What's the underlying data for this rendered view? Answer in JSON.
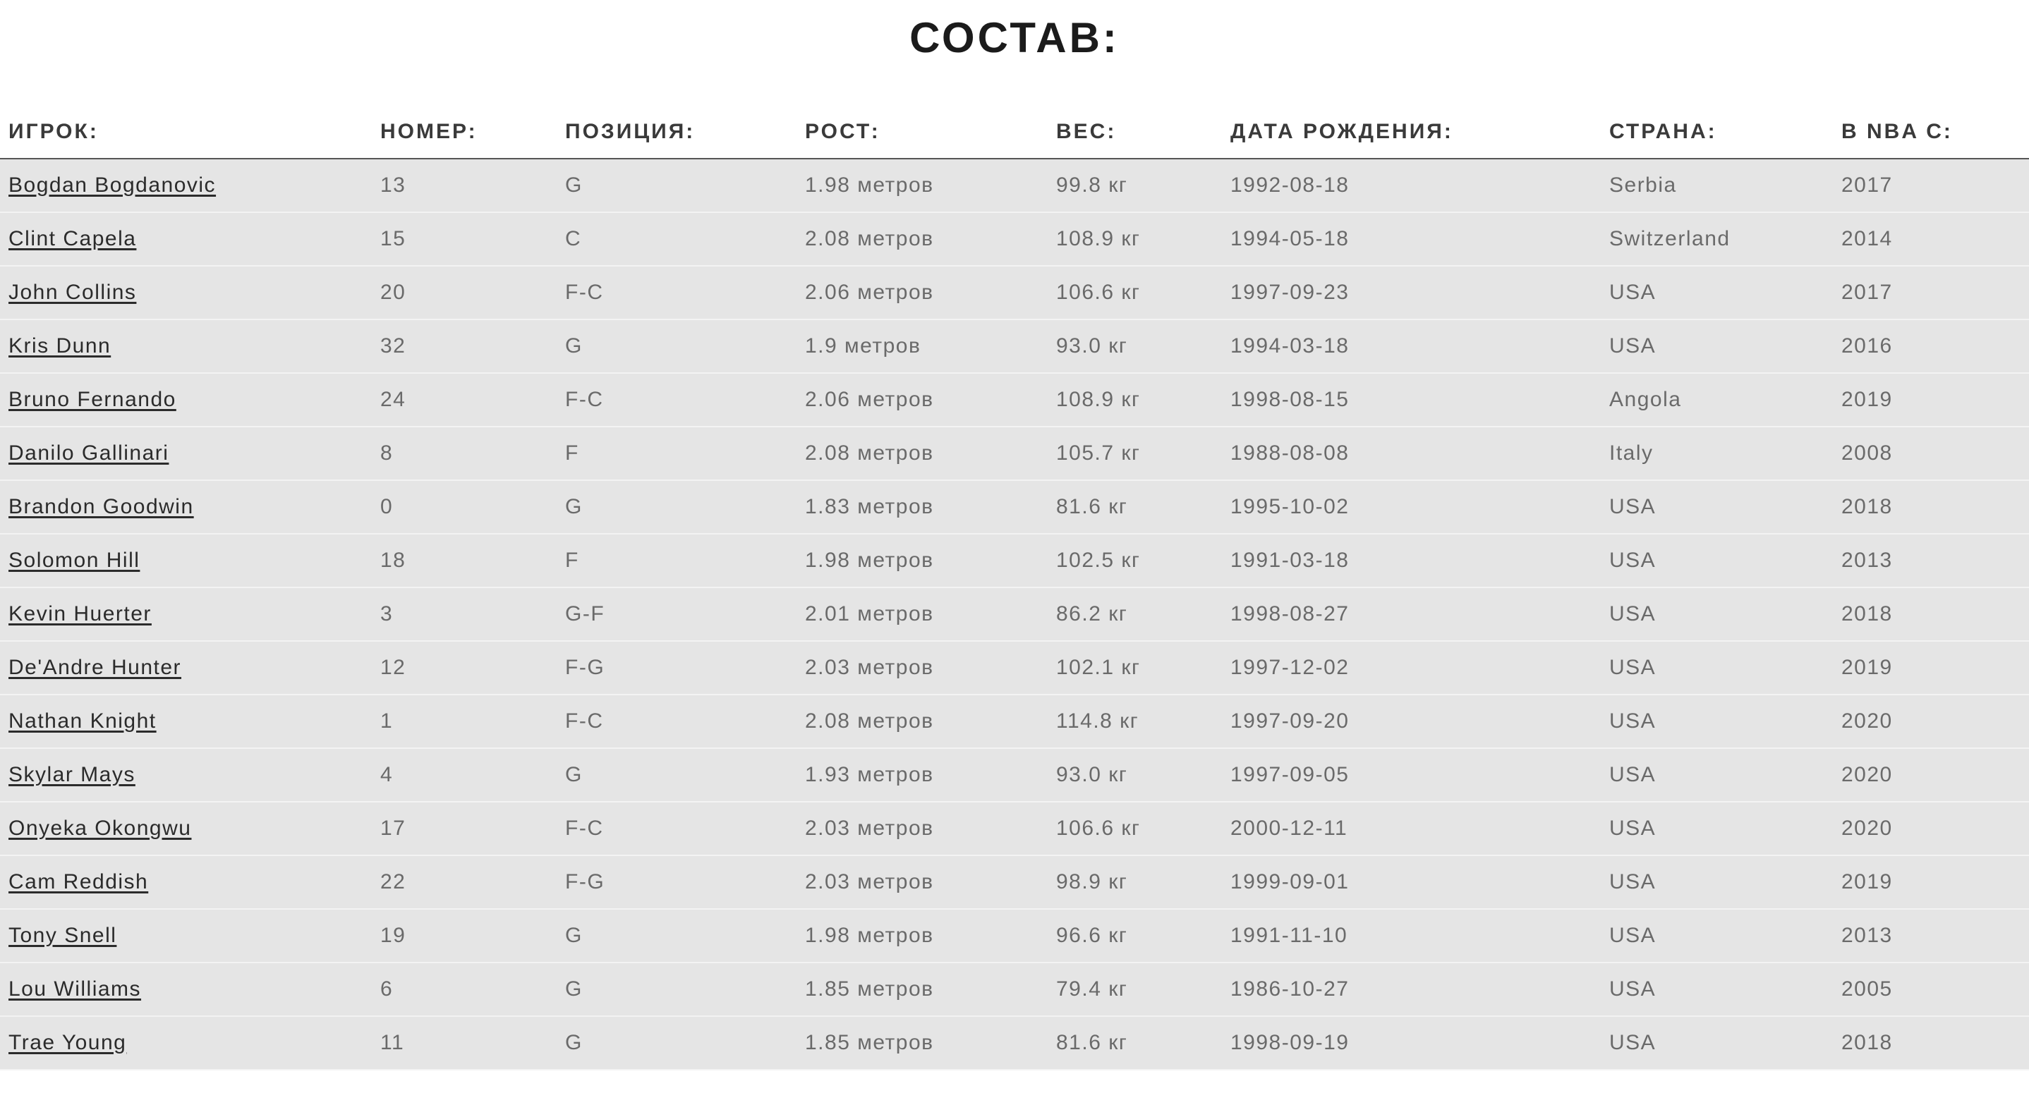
{
  "page": {
    "title": "СОСТАВ:"
  },
  "table": {
    "headers": {
      "player": "ИГРОК:",
      "number": "НОМЕР:",
      "position": "ПОЗИЦИЯ:",
      "height": "РОСТ:",
      "weight": "ВЕС:",
      "birthdate": "ДАТА РОЖДЕНИЯ:",
      "country": "СТРАНА:",
      "nba_since": "В NBA С:"
    },
    "rows": [
      {
        "player": "Bogdan Bogdanovic",
        "number": "13",
        "position": "G",
        "height": "1.98 метров",
        "weight": "99.8 кг",
        "birthdate": "1992-08-18",
        "country": "Serbia",
        "nba_since": "2017"
      },
      {
        "player": "Clint Capela",
        "number": "15",
        "position": "C",
        "height": "2.08 метров",
        "weight": "108.9 кг",
        "birthdate": "1994-05-18",
        "country": "Switzerland",
        "nba_since": "2014"
      },
      {
        "player": "John Collins",
        "number": "20",
        "position": "F-C",
        "height": "2.06 метров",
        "weight": "106.6 кг",
        "birthdate": "1997-09-23",
        "country": "USA",
        "nba_since": "2017"
      },
      {
        "player": "Kris Dunn",
        "number": "32",
        "position": "G",
        "height": "1.9 метров",
        "weight": "93.0 кг",
        "birthdate": "1994-03-18",
        "country": "USA",
        "nba_since": "2016"
      },
      {
        "player": "Bruno Fernando",
        "number": "24",
        "position": "F-C",
        "height": "2.06 метров",
        "weight": "108.9 кг",
        "birthdate": "1998-08-15",
        "country": "Angola",
        "nba_since": "2019"
      },
      {
        "player": "Danilo Gallinari",
        "number": "8",
        "position": "F",
        "height": "2.08 метров",
        "weight": "105.7 кг",
        "birthdate": "1988-08-08",
        "country": "Italy",
        "nba_since": "2008"
      },
      {
        "player": "Brandon Goodwin",
        "number": "0",
        "position": "G",
        "height": "1.83 метров",
        "weight": "81.6 кг",
        "birthdate": "1995-10-02",
        "country": "USA",
        "nba_since": "2018"
      },
      {
        "player": "Solomon Hill",
        "number": "18",
        "position": "F",
        "height": "1.98 метров",
        "weight": "102.5 кг",
        "birthdate": "1991-03-18",
        "country": "USA",
        "nba_since": "2013"
      },
      {
        "player": "Kevin Huerter",
        "number": "3",
        "position": "G-F",
        "height": "2.01 метров",
        "weight": "86.2 кг",
        "birthdate": "1998-08-27",
        "country": "USA",
        "nba_since": "2018"
      },
      {
        "player": "De'Andre Hunter",
        "number": "12",
        "position": "F-G",
        "height": "2.03 метров",
        "weight": "102.1 кг",
        "birthdate": "1997-12-02",
        "country": "USA",
        "nba_since": "2019"
      },
      {
        "player": "Nathan Knight",
        "number": "1",
        "position": "F-C",
        "height": "2.08 метров",
        "weight": "114.8 кг",
        "birthdate": "1997-09-20",
        "country": "USA",
        "nba_since": "2020"
      },
      {
        "player": "Skylar Mays",
        "number": "4",
        "position": "G",
        "height": "1.93 метров",
        "weight": "93.0 кг",
        "birthdate": "1997-09-05",
        "country": "USA",
        "nba_since": "2020"
      },
      {
        "player": "Onyeka Okongwu",
        "number": "17",
        "position": "F-C",
        "height": "2.03 метров",
        "weight": "106.6 кг",
        "birthdate": "2000-12-11",
        "country": "USA",
        "nba_since": "2020"
      },
      {
        "player": "Cam Reddish",
        "number": "22",
        "position": "F-G",
        "height": "2.03 метров",
        "weight": "98.9 кг",
        "birthdate": "1999-09-01",
        "country": "USA",
        "nba_since": "2019"
      },
      {
        "player": "Tony Snell",
        "number": "19",
        "position": "G",
        "height": "1.98 метров",
        "weight": "96.6 кг",
        "birthdate": "1991-11-10",
        "country": "USA",
        "nba_since": "2013"
      },
      {
        "player": "Lou Williams",
        "number": "6",
        "position": "G",
        "height": "1.85 метров",
        "weight": "79.4 кг",
        "birthdate": "1986-10-27",
        "country": "USA",
        "nba_since": "2005"
      },
      {
        "player": "Trae Young",
        "number": "11",
        "position": "G",
        "height": "1.85 метров",
        "weight": "81.6 кг",
        "birthdate": "1998-09-19",
        "country": "USA",
        "nba_since": "2018"
      }
    ]
  }
}
